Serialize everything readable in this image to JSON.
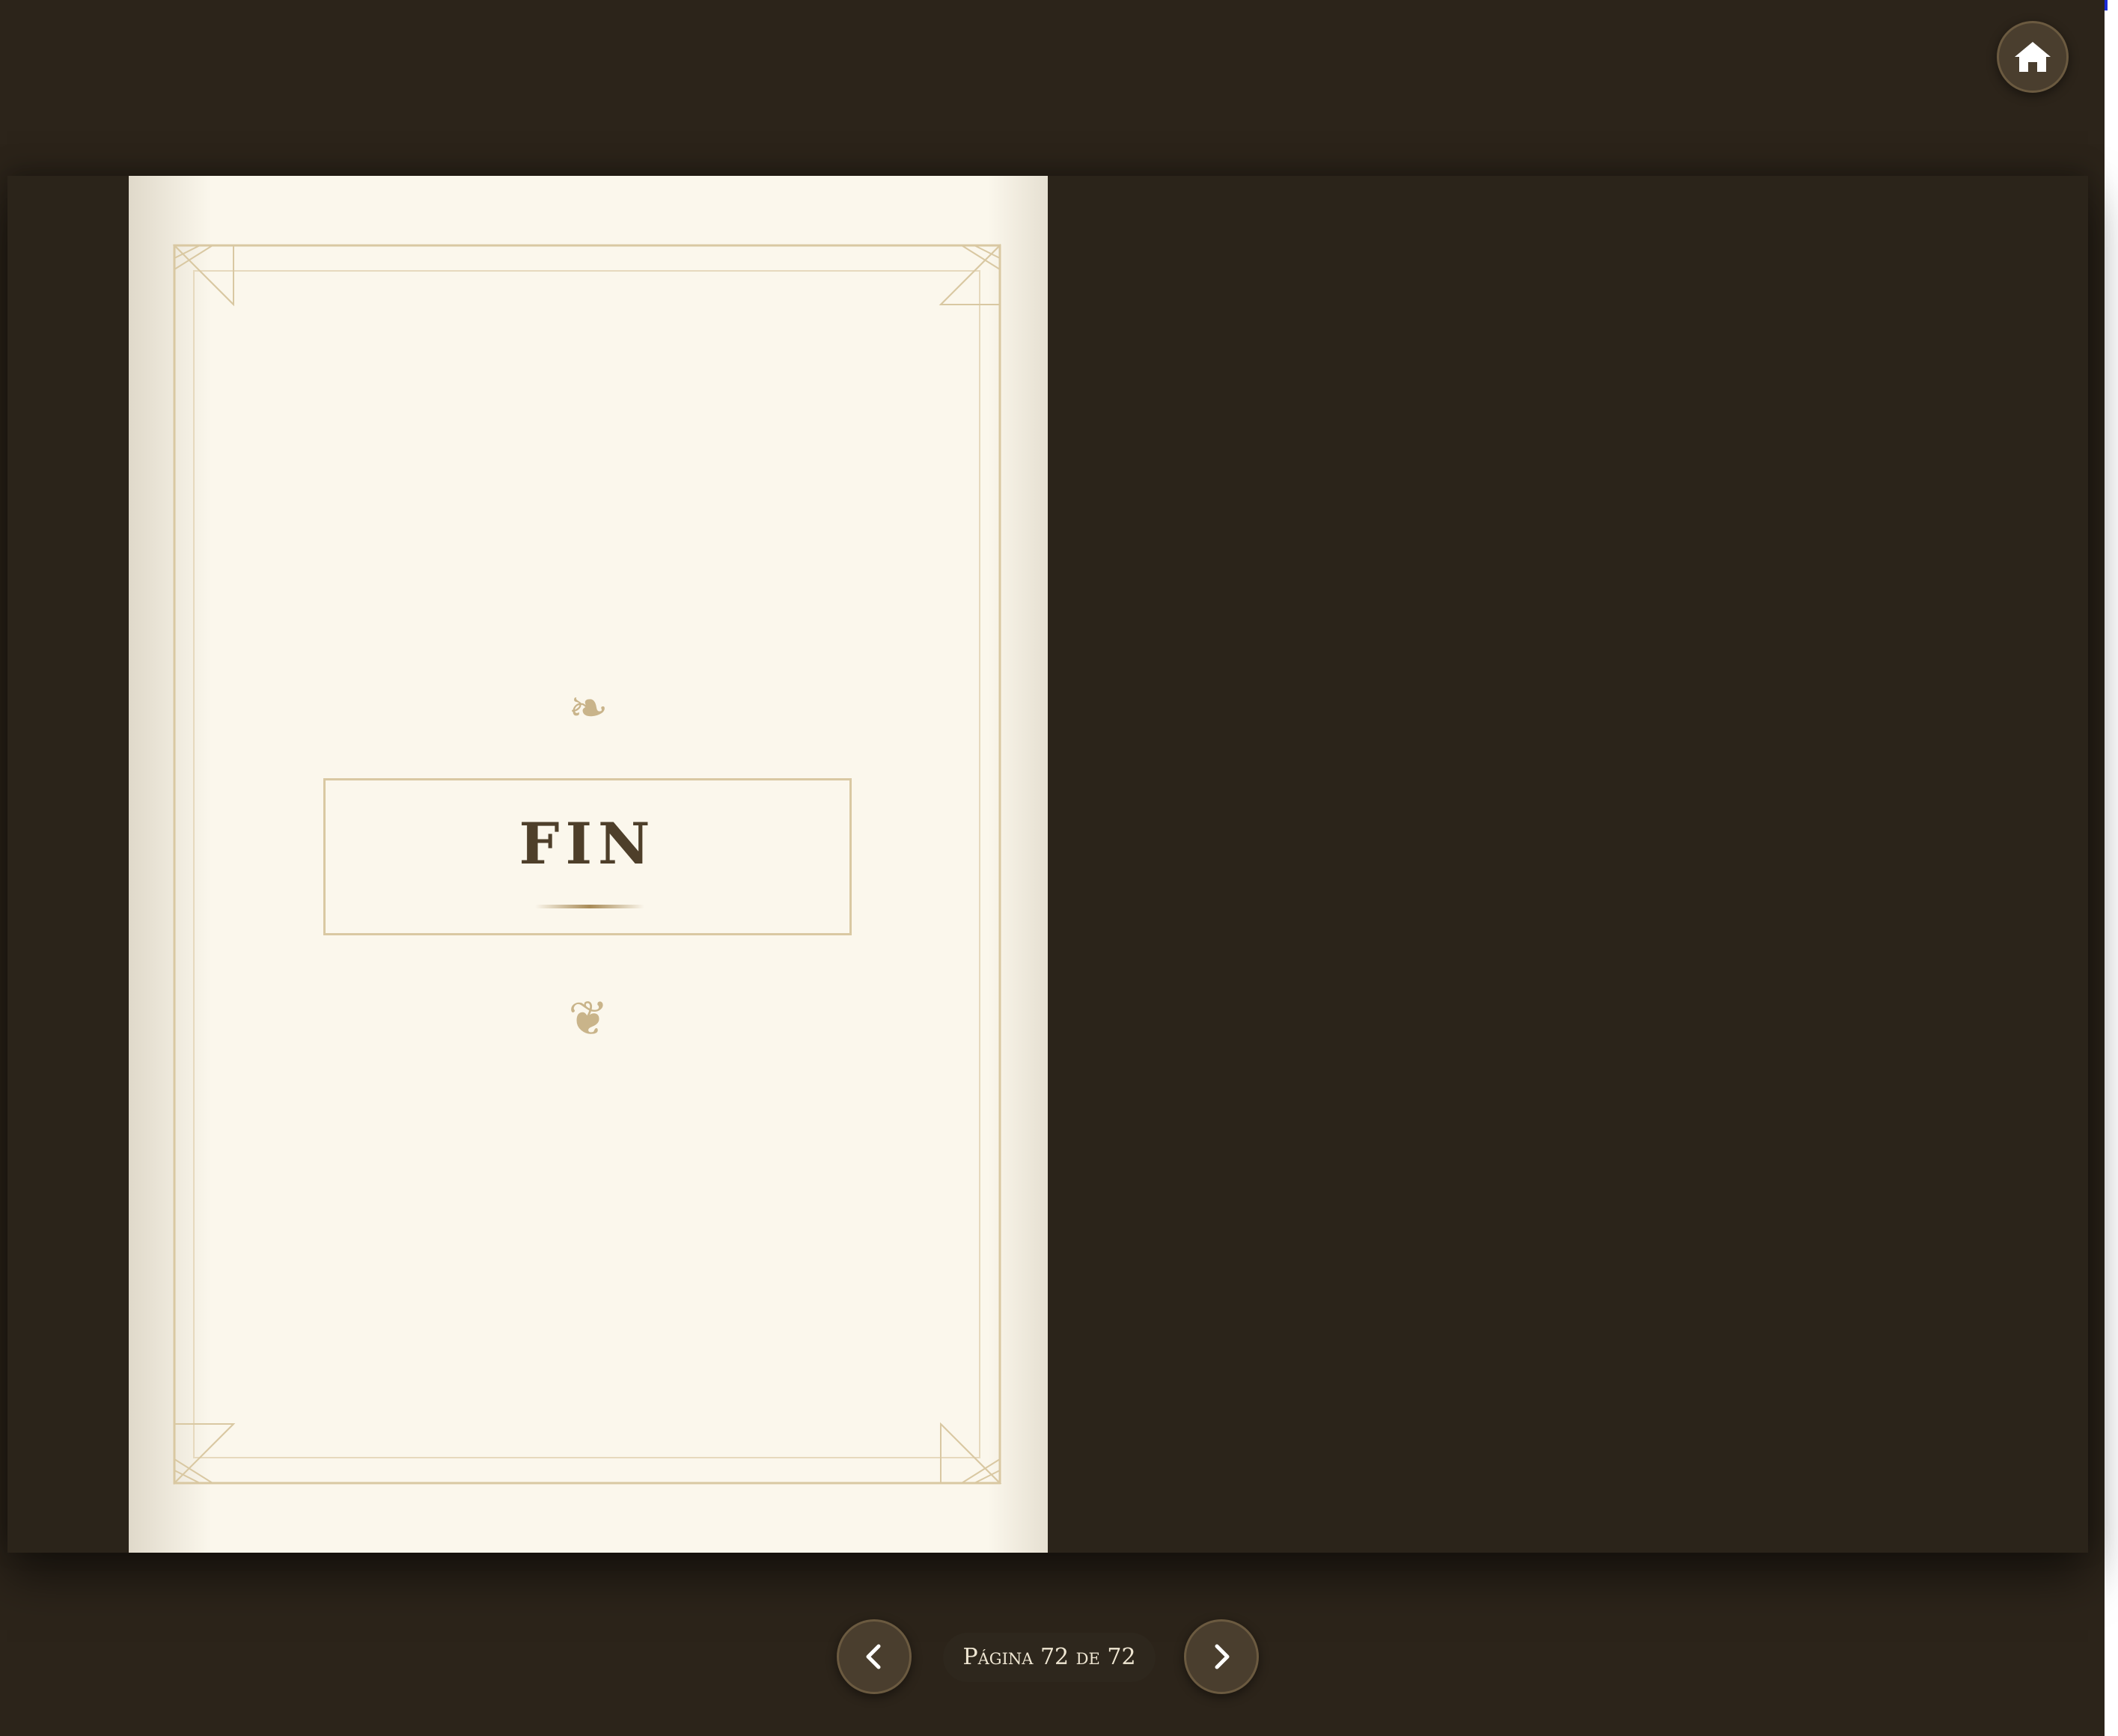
{
  "header": {
    "home_button_icon": "home-icon"
  },
  "page": {
    "title": "FIN",
    "top_ornament": "❧",
    "bottom_ornament": "❦"
  },
  "footer": {
    "prev_icon": "chevron-left-icon",
    "next_icon": "chevron-right-icon",
    "page_indicator": "Página 72 de 72"
  },
  "colors": {
    "background": "#2c241a",
    "page": "#fbf7ec",
    "accent_gold": "#c9b48a",
    "title": "#4e3f2a",
    "button": "#4a3e2e"
  }
}
